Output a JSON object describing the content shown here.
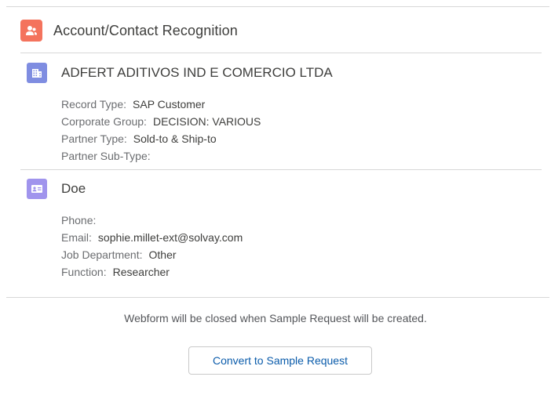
{
  "card": {
    "title": "Account/Contact Recognition",
    "icon": "contact-recognition-icon",
    "icon_color": "#f4735d"
  },
  "account": {
    "icon": "building-icon",
    "icon_color": "#7f8de1",
    "name": "ADFERT ADITIVOS IND E COMERCIO LTDA",
    "fields": [
      {
        "label": "Record Type:",
        "value": "SAP Customer"
      },
      {
        "label": "Corporate Group:",
        "value": "DECISION: VARIOUS"
      },
      {
        "label": "Partner Type:",
        "value": "Sold-to & Ship-to"
      },
      {
        "label": "Partner Sub-Type:",
        "value": ""
      }
    ]
  },
  "contact": {
    "icon": "contact-card-icon",
    "icon_color": "#a094ed",
    "name": "Doe",
    "fields": [
      {
        "label": "Phone:",
        "value": ""
      },
      {
        "label": "Email:",
        "value": "sophie.millet-ext@solvay.com"
      },
      {
        "label": "Job Department:",
        "value": "Other"
      },
      {
        "label": "Function:",
        "value": "Researcher"
      }
    ]
  },
  "footer": {
    "notice": "Webform will be closed when Sample Request will be created.",
    "convert_label": "Convert to Sample Request",
    "link_color": "#0b5cab"
  }
}
